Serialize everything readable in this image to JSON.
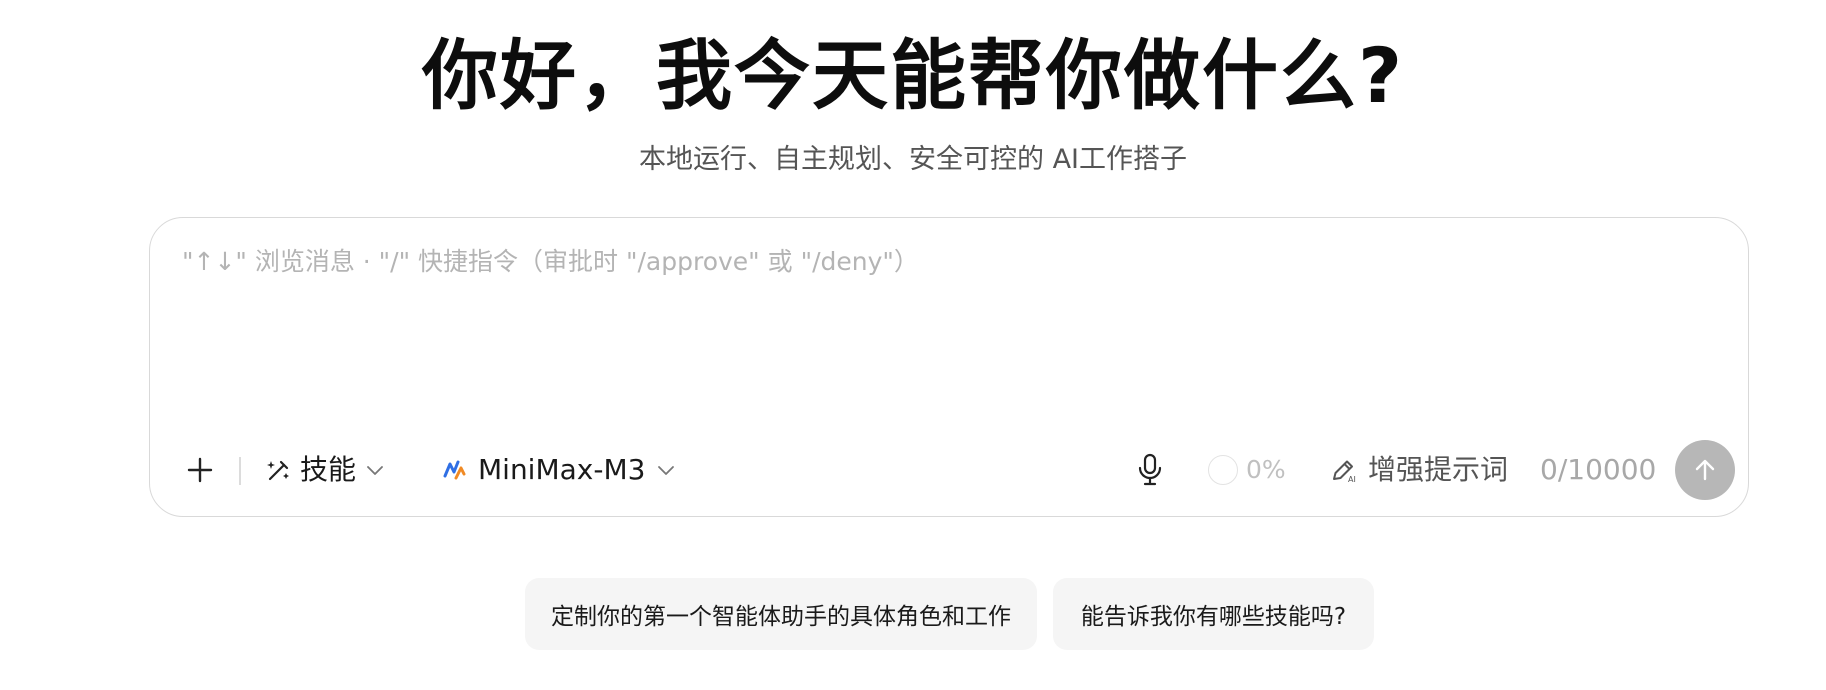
{
  "hero": {
    "title": "你好，我今天能帮你做什么?",
    "subtitle": "本地运行、自主规划、安全可控的 AI工作搭子"
  },
  "composer": {
    "placeholder": "\"↑↓\" 浏览消息 · \"/\" 快捷指令（审批时 \"/approve\" 或 \"/deny\"）",
    "value": ""
  },
  "toolbar": {
    "attach_icon": "plus-icon",
    "skills_icon": "magic-wand-icon",
    "skills_label": "技能",
    "model_icon": "minimax-logo-icon",
    "model_label": "MiniMax-M3",
    "mic_icon": "microphone-icon",
    "progress_text": "0%",
    "progress_value": 0,
    "enhance_icon": "ai-pen-icon",
    "enhance_label": "增强提示词",
    "char_count": "0/10000",
    "send_icon": "arrow-up-icon"
  },
  "suggestions": [
    {
      "label": "定制你的第一个智能体助手的具体角色和工作"
    },
    {
      "label": "能告诉我你有哪些技能吗?"
    }
  ],
  "colors": {
    "send_button_disabled": "#b7b7b7",
    "border": "#d9d9d9",
    "suggestion_bg": "#f5f5f5",
    "model_logo_blue": "#2f6fe4",
    "model_logo_orange": "#f08a24"
  }
}
